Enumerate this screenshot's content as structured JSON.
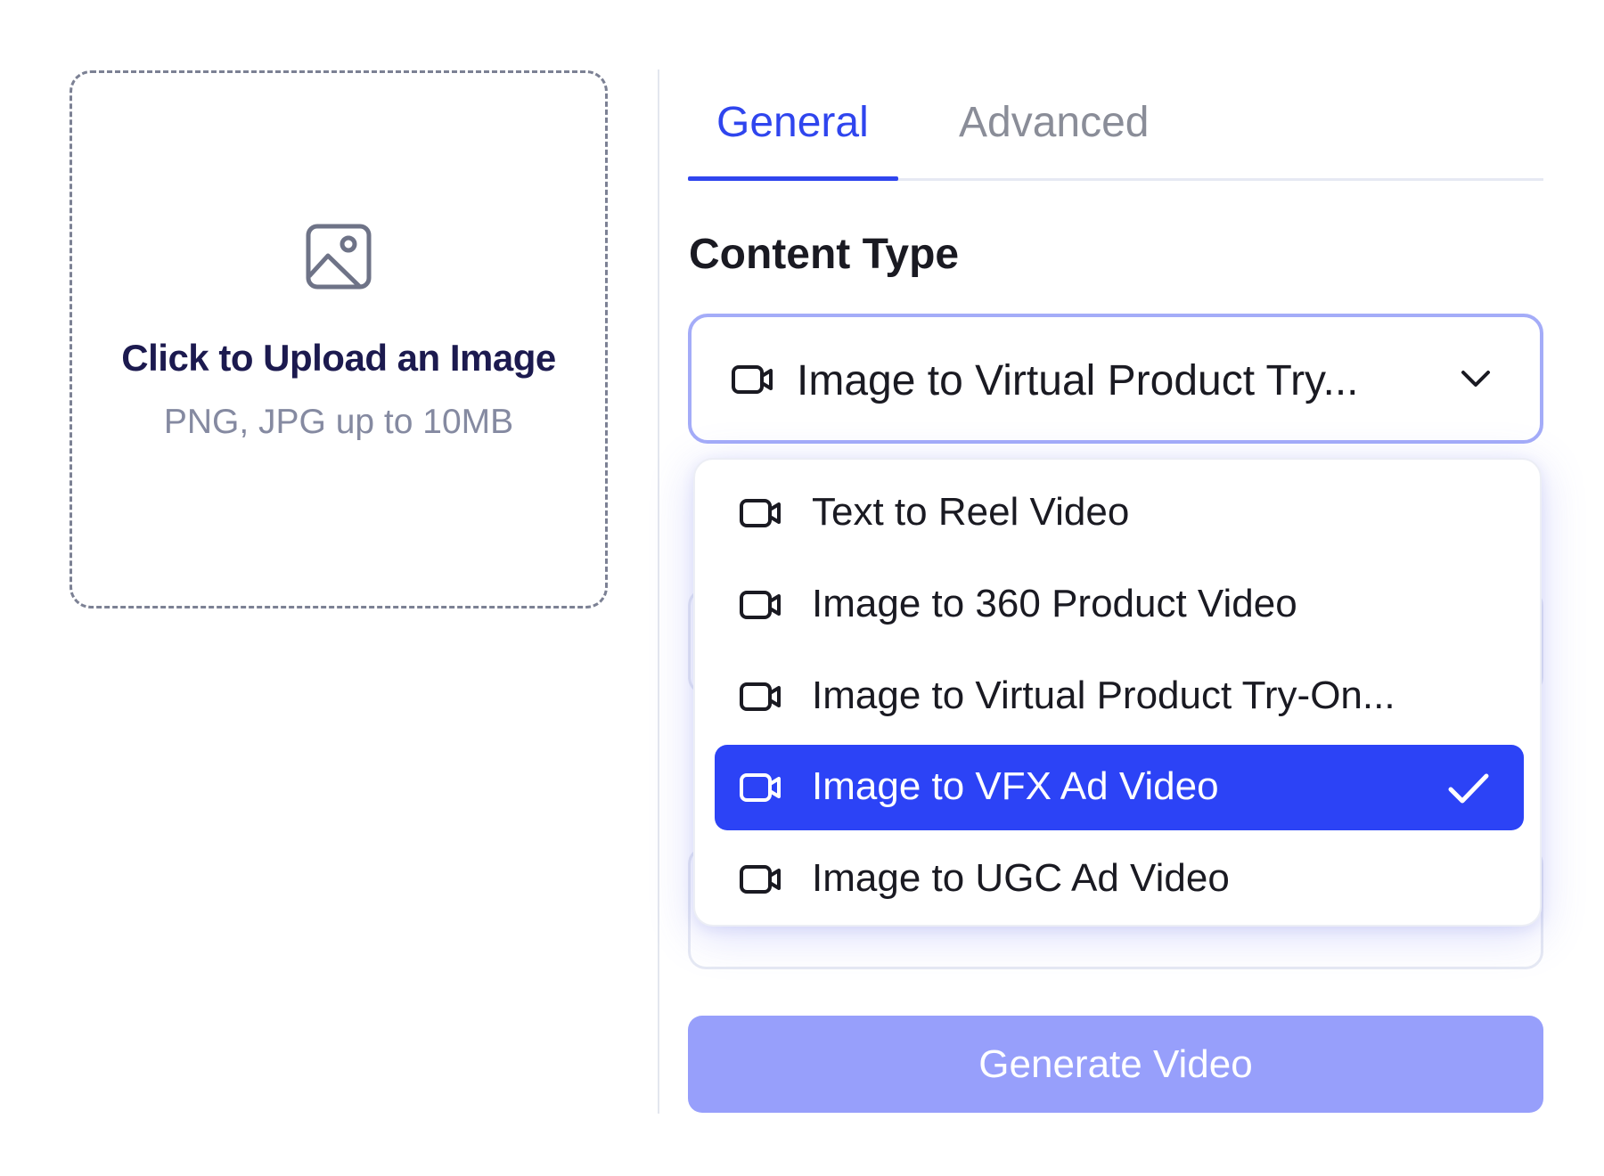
{
  "upload": {
    "title": "Click to Upload an Image",
    "hint": "PNG, JPG up to 10MB",
    "icon": "image-icon"
  },
  "tabs": [
    {
      "label": "General",
      "active": true
    },
    {
      "label": "Advanced",
      "active": false
    }
  ],
  "content_type": {
    "heading": "Content Type",
    "selected_value": "Image to Virtual Product Try...",
    "icon": "video-camera-icon",
    "options": [
      {
        "label": "Text to Reel Video",
        "selected": false
      },
      {
        "label": "Image to 360 Product Video",
        "selected": false
      },
      {
        "label": "Image to Virtual Product Try-On...",
        "selected": false
      },
      {
        "label": "Image to VFX Ad Video",
        "selected": true
      },
      {
        "label": "Image to UGC Ad Video",
        "selected": false
      }
    ]
  },
  "generate_button": {
    "label": "Generate Video"
  },
  "colors": {
    "accent": "#2f45ee",
    "selected_option_bg": "#2c43f6",
    "button_disabled_bg": "#979ffb",
    "select_border": "#a4acf8"
  }
}
